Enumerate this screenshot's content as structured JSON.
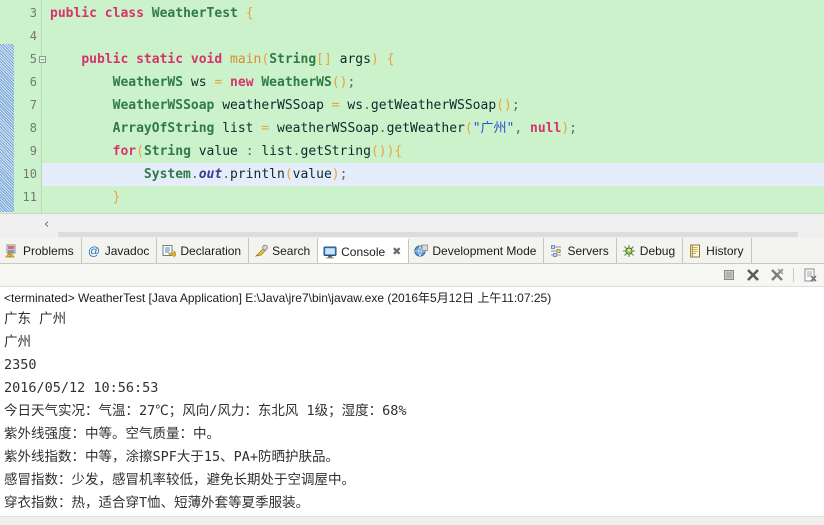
{
  "editor": {
    "lines": [
      {
        "num": "3",
        "folded": false,
        "current": false,
        "tokens": [
          {
            "t": "kw",
            "v": "public"
          },
          {
            "t": "plain",
            "v": " "
          },
          {
            "t": "kw",
            "v": "class"
          },
          {
            "t": "plain",
            "v": " "
          },
          {
            "t": "type",
            "v": "WeatherTest"
          },
          {
            "t": "plain",
            "v": " "
          },
          {
            "t": "brk",
            "v": "{"
          }
        ]
      },
      {
        "num": "4",
        "folded": false,
        "current": false,
        "tokens": []
      },
      {
        "num": "5",
        "folded": true,
        "current": false,
        "tokens": [
          {
            "t": "plain",
            "v": "    "
          },
          {
            "t": "kw",
            "v": "public"
          },
          {
            "t": "plain",
            "v": " "
          },
          {
            "t": "kw",
            "v": "static"
          },
          {
            "t": "plain",
            "v": " "
          },
          {
            "t": "kw",
            "v": "void"
          },
          {
            "t": "plain",
            "v": " "
          },
          {
            "t": "method",
            "v": "main"
          },
          {
            "t": "brk",
            "v": "("
          },
          {
            "t": "type",
            "v": "String"
          },
          {
            "t": "brk",
            "v": "[]"
          },
          {
            "t": "plain",
            "v": " args"
          },
          {
            "t": "brk",
            "v": ")"
          },
          {
            "t": "plain",
            "v": " "
          },
          {
            "t": "brk",
            "v": "{"
          }
        ]
      },
      {
        "num": "6",
        "folded": false,
        "current": false,
        "tokens": [
          {
            "t": "plain",
            "v": "        "
          },
          {
            "t": "type",
            "v": "WeatherWS"
          },
          {
            "t": "plain",
            "v": " ws "
          },
          {
            "t": "brk",
            "v": "="
          },
          {
            "t": "plain",
            "v": " "
          },
          {
            "t": "kw",
            "v": "new"
          },
          {
            "t": "plain",
            "v": " "
          },
          {
            "t": "type",
            "v": "WeatherWS"
          },
          {
            "t": "brk",
            "v": "()"
          },
          {
            "t": "punct",
            "v": ";"
          }
        ]
      },
      {
        "num": "7",
        "folded": false,
        "current": false,
        "tokens": [
          {
            "t": "plain",
            "v": "        "
          },
          {
            "t": "type",
            "v": "WeatherWSSoap"
          },
          {
            "t": "plain",
            "v": " weatherWSSoap "
          },
          {
            "t": "brk",
            "v": "="
          },
          {
            "t": "plain",
            "v": " ws"
          },
          {
            "t": "punct",
            "v": "."
          },
          {
            "t": "plain",
            "v": "getWeatherWSSoap"
          },
          {
            "t": "brk",
            "v": "()"
          },
          {
            "t": "punct",
            "v": ";"
          }
        ]
      },
      {
        "num": "8",
        "folded": false,
        "current": false,
        "tokens": [
          {
            "t": "plain",
            "v": "        "
          },
          {
            "t": "type",
            "v": "ArrayOfString"
          },
          {
            "t": "plain",
            "v": " list "
          },
          {
            "t": "brk",
            "v": "="
          },
          {
            "t": "plain",
            "v": " weatherWSSoap"
          },
          {
            "t": "punct",
            "v": "."
          },
          {
            "t": "plain",
            "v": "getWeather"
          },
          {
            "t": "brk",
            "v": "("
          },
          {
            "t": "str",
            "v": "\"广州\""
          },
          {
            "t": "punct",
            "v": ", "
          },
          {
            "t": "kw",
            "v": "null"
          },
          {
            "t": "brk",
            "v": ")"
          },
          {
            "t": "punct",
            "v": ";"
          }
        ]
      },
      {
        "num": "9",
        "folded": false,
        "current": false,
        "tokens": [
          {
            "t": "plain",
            "v": "        "
          },
          {
            "t": "kw",
            "v": "for"
          },
          {
            "t": "brk",
            "v": "("
          },
          {
            "t": "type",
            "v": "String"
          },
          {
            "t": "plain",
            "v": " value "
          },
          {
            "t": "punct",
            "v": ": "
          },
          {
            "t": "plain",
            "v": "list"
          },
          {
            "t": "punct",
            "v": "."
          },
          {
            "t": "plain",
            "v": "getString"
          },
          {
            "t": "brk",
            "v": "()){"
          }
        ]
      },
      {
        "num": "10",
        "folded": false,
        "current": true,
        "tokens": [
          {
            "t": "plain",
            "v": "            "
          },
          {
            "t": "type",
            "v": "System"
          },
          {
            "t": "punct",
            "v": "."
          },
          {
            "t": "field",
            "v": "out"
          },
          {
            "t": "punct",
            "v": "."
          },
          {
            "t": "plain",
            "v": "println"
          },
          {
            "t": "brk",
            "v": "("
          },
          {
            "t": "plain",
            "v": "value"
          },
          {
            "t": "brk",
            "v": ")"
          },
          {
            "t": "punct",
            "v": ";"
          }
        ]
      },
      {
        "num": "11",
        "folded": false,
        "current": false,
        "tokens": [
          {
            "t": "plain",
            "v": "        "
          },
          {
            "t": "brk",
            "v": "}"
          }
        ]
      }
    ],
    "scroll_left_glyph": "‹"
  },
  "tabs": [
    {
      "label": "Problems",
      "icon": "problems-icon",
      "active": false,
      "closable": false
    },
    {
      "label": "Javadoc",
      "icon": "javadoc-icon",
      "active": false,
      "closable": false
    },
    {
      "label": "Declaration",
      "icon": "declaration-icon",
      "active": false,
      "closable": false
    },
    {
      "label": "Search",
      "icon": "search-icon",
      "active": false,
      "closable": false
    },
    {
      "label": "Console",
      "icon": "console-icon",
      "active": true,
      "closable": true,
      "close_glyph": "✖"
    },
    {
      "label": "Development Mode",
      "icon": "development-mode-icon",
      "active": false,
      "closable": false
    },
    {
      "label": "Servers",
      "icon": "servers-icon",
      "active": false,
      "closable": false
    },
    {
      "label": "Debug",
      "icon": "debug-icon",
      "active": false,
      "closable": false
    },
    {
      "label": "History",
      "icon": "history-icon",
      "active": false,
      "closable": false
    }
  ],
  "console_toolbar": {
    "buttons": [
      {
        "name": "terminate-button",
        "title": "Terminate"
      },
      {
        "name": "remove-button",
        "title": "Remove Launch"
      },
      {
        "name": "remove-all-button",
        "title": "Remove All Terminated Launches"
      },
      {
        "name": "clear-console-button",
        "title": "Clear Console"
      }
    ]
  },
  "console": {
    "status_line": "<terminated> WeatherTest [Java Application] E:\\Java\\jre7\\bin\\javaw.exe (2016年5月12日 上午11:07:25)",
    "output": [
      "广东 广州",
      "广州",
      "2350",
      "2016/05/12 10:56:53",
      "今日天气实况：气温：27℃；风向/风力：东北风 1级；湿度：68%",
      "紫外线强度：中等。空气质量：中。",
      "紫外线指数：中等，涂擦SPF大于15、PA+防晒护肤品。",
      "感冒指数：少发，感冒机率较低，避免长期处于空调屋中。",
      "穿衣指数：热，适合穿T恤、短薄外套等夏季服装。"
    ]
  },
  "colors": {
    "editor_background": "#ccf2cc",
    "current_line": "#e6edfa",
    "keyword": "#d6336c",
    "type": "#2f7a46",
    "string": "#2a4fd4",
    "bracket": "#e8a33d",
    "static_field": "#3b3b8f",
    "tab_active_background": "#ffffff",
    "tabbar_background": "#f3f3f0"
  }
}
